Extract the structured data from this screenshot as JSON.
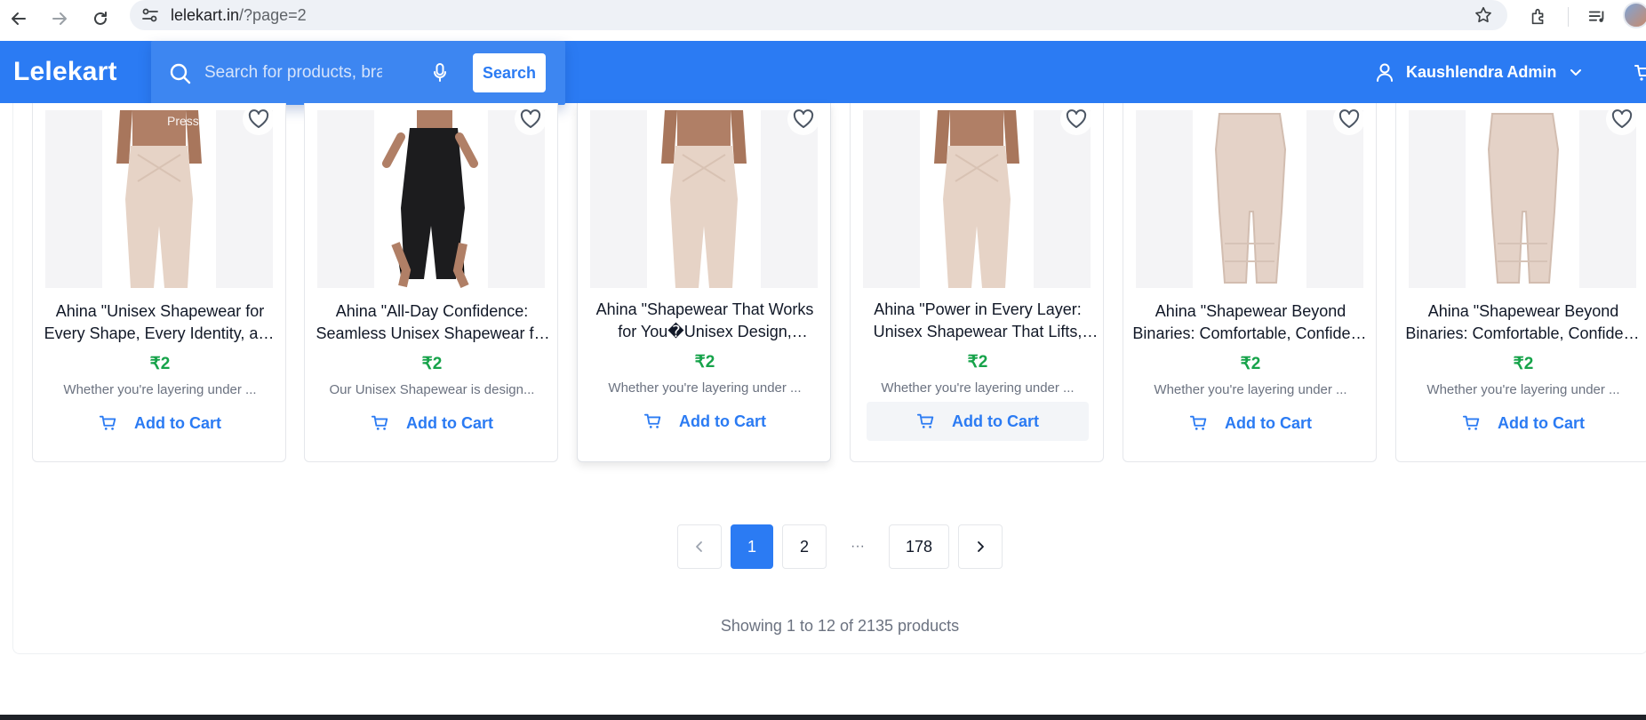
{
  "browser": {
    "url_domain": "lelekart.in",
    "url_path": "/?page=2"
  },
  "header": {
    "logo": "Lelekart",
    "search_placeholder": "Search for products, brands and more",
    "search_button": "Search",
    "user_name": "Kaushlendra Admin",
    "voice_hint": "Press"
  },
  "products": [
    {
      "title": "Ahina \"Unisex Shapewear for Every Shape, Every Identity, and Every Body\"",
      "price": "₹2",
      "description": "Whether you're layering under ...",
      "add_to_cart": "Add to Cart"
    },
    {
      "title": "Ahina \"All-Day Confidence: Seamless Unisex Shapewear for Everyone\"",
      "price": "₹2",
      "description": "Our Unisex Shapewear is design...",
      "add_to_cart": "Add to Cart"
    },
    {
      "title": "Ahina \"Shapewear That Works for You�Unisex Design, Universal Comfort\"",
      "price": "₹2",
      "description": "Whether you're layering under ...",
      "add_to_cart": "Add to Cart"
    },
    {
      "title": "Ahina \"Power in Every Layer: Unisex Shapewear That Lifts, Smooths and Supports\"",
      "price": "₹2",
      "description": "Whether you're layering under ...",
      "add_to_cart": "Add to Cart"
    },
    {
      "title": "Ahina \"Shapewear Beyond Binaries: Comfortable, Confident, Inclusive\"",
      "price": "₹2",
      "description": "Whether you're layering under ...",
      "add_to_cart": "Add to Cart"
    },
    {
      "title": "Ahina \"Shapewear Beyond Binaries: Comfortable, Confident, Inclusive\"",
      "price": "₹2",
      "description": "Whether you're layering under ...",
      "add_to_cart": "Add to Cart"
    }
  ],
  "pagination": {
    "pages": [
      "1",
      "2",
      "···",
      "178"
    ],
    "current": "1"
  },
  "summary": "Showing 1 to 12 of 2135 products",
  "colors": {
    "brand": "#2b7bf3",
    "price": "#16a34a"
  }
}
